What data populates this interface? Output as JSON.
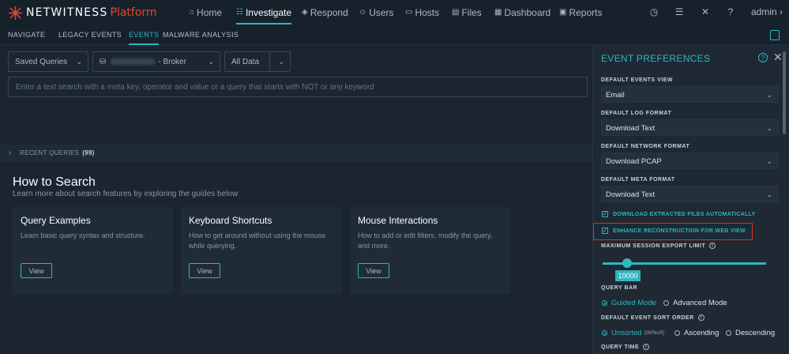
{
  "header": {
    "brand": "NETWITNESS",
    "platform": "Platform",
    "nav": [
      {
        "label": "Home",
        "icon": "home-icon",
        "glyph": "⌂"
      },
      {
        "label": "Investigate",
        "icon": "investigate-icon",
        "glyph": "☷"
      },
      {
        "label": "Respond",
        "icon": "shield-icon",
        "glyph": "◈"
      },
      {
        "label": "Users",
        "icon": "users-icon",
        "glyph": "☺"
      },
      {
        "label": "Hosts",
        "icon": "hosts-icon",
        "glyph": "▭"
      },
      {
        "label": "Files",
        "icon": "files-icon",
        "glyph": "▤"
      },
      {
        "label": "Dashboard",
        "icon": "dashboard-icon",
        "glyph": "▦"
      },
      {
        "label": "Reports",
        "icon": "reports-icon",
        "glyph": "▣"
      }
    ],
    "active_nav": "Investigate",
    "user": "admin",
    "accent": "#2fb6bf",
    "brand_red": "#e0492f"
  },
  "subnav": {
    "tabs": [
      "NAVIGATE",
      "LEGACY EVENTS",
      "EVENTS",
      "MALWARE ANALYSIS"
    ],
    "active": "EVENTS"
  },
  "query": {
    "saved_queries": "Saved Queries",
    "service_suffix": "- Broker",
    "time_range": "All Data",
    "search_placeholder": "Enter a text search with a meta key, operator and value or a query that starts with NOT or any keyword"
  },
  "recent": {
    "label": "RECENT QUERIES",
    "count": "(99)"
  },
  "how": {
    "title": "How to Search",
    "subtitle": "Learn more about search features by exploring the guides below",
    "cards": [
      {
        "title": "Query Examples",
        "desc": "Learn basic query syntax and structure.",
        "button": "View"
      },
      {
        "title": "Keyboard Shortcuts",
        "desc": "How to get around without using the mouse while querying.",
        "button": "View"
      },
      {
        "title": "Mouse Interactions",
        "desc": "How to add or edit filters, modify the query, and more.",
        "button": "View"
      }
    ]
  },
  "prefs": {
    "title": "EVENT PREFERENCES",
    "default_events_view": {
      "label": "DEFAULT EVENTS VIEW",
      "value": "Email"
    },
    "default_log_format": {
      "label": "DEFAULT LOG FORMAT",
      "value": "Download Text"
    },
    "default_network_format": {
      "label": "DEFAULT NETWORK FORMAT",
      "value": "Download PCAP"
    },
    "default_meta_format": {
      "label": "DEFAULT META FORMAT",
      "value": "Download Text"
    },
    "download_extracted": "DOWNLOAD EXTRACTED FILES AUTOMATICALLY",
    "enhance_reconstruction": "ENHANCE RECONSTRUCTION FOR WEB VIEW",
    "max_export": {
      "label": "MAXIMUM SESSION EXPORT LIMIT",
      "value": "10000"
    },
    "query_bar": {
      "label": "QUERY BAR",
      "options": [
        "Guided Mode",
        "Advanced Mode"
      ],
      "selected": "Guided Mode"
    },
    "sort_order": {
      "label": "DEFAULT EVENT SORT ORDER",
      "options": [
        "Unsorted",
        "Ascending",
        "Descending"
      ],
      "selected": "Unsorted",
      "default_tag": "(default)"
    },
    "query_time": {
      "label": "QUERY TIME"
    }
  }
}
